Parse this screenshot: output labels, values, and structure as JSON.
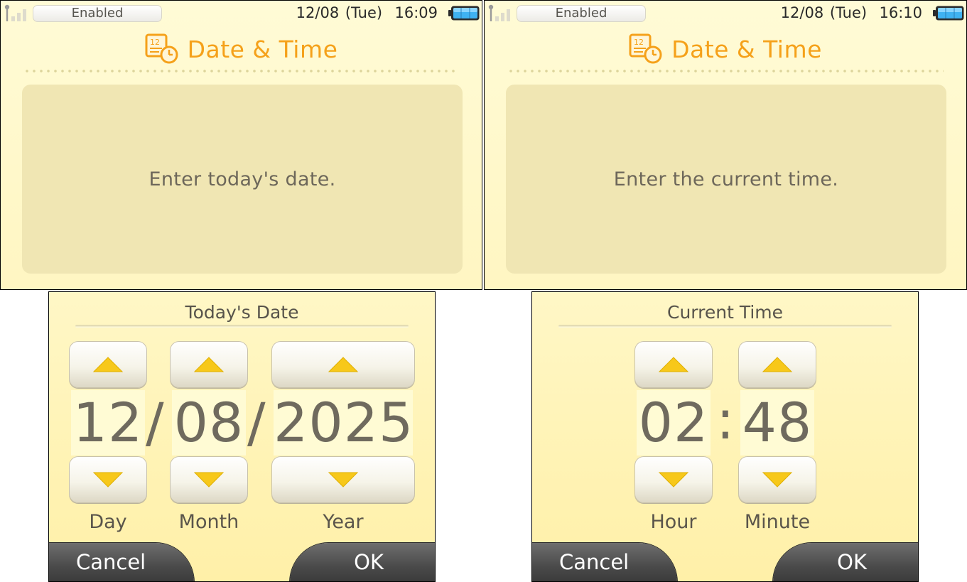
{
  "colors": {
    "title_orange": "#f5a11a",
    "message_box": "#f0e6b3",
    "arrow_yellow": "#f7c81a",
    "bottom_bar": "#4a4a4a"
  },
  "icons": {
    "signal": "signal-strength-icon",
    "battery": "battery-icon",
    "title": "calendar-clock-icon",
    "up": "triangle-up-icon",
    "down": "triangle-down-icon"
  },
  "top_left": {
    "status": {
      "wireless": "Enabled",
      "date": "12/08 (Tue)",
      "time": "16:09"
    },
    "title": "Date & Time",
    "message": "Enter today's date."
  },
  "top_right": {
    "status": {
      "wireless": "Enabled",
      "date": "12/08 (Tue)",
      "time": "16:10"
    },
    "title": "Date & Time",
    "message": "Enter the current time."
  },
  "date_panel": {
    "title": "Today's Date",
    "day": "12",
    "month": "08",
    "year": "2025",
    "separator": "/",
    "labels": {
      "day": "Day",
      "month": "Month",
      "year": "Year"
    },
    "cancel": "Cancel",
    "ok": "OK"
  },
  "time_panel": {
    "title": "Current Time",
    "hour": "02",
    "minute": "48",
    "separator": ":",
    "labels": {
      "hour": "Hour",
      "minute": "Minute"
    },
    "cancel": "Cancel",
    "ok": "OK"
  }
}
